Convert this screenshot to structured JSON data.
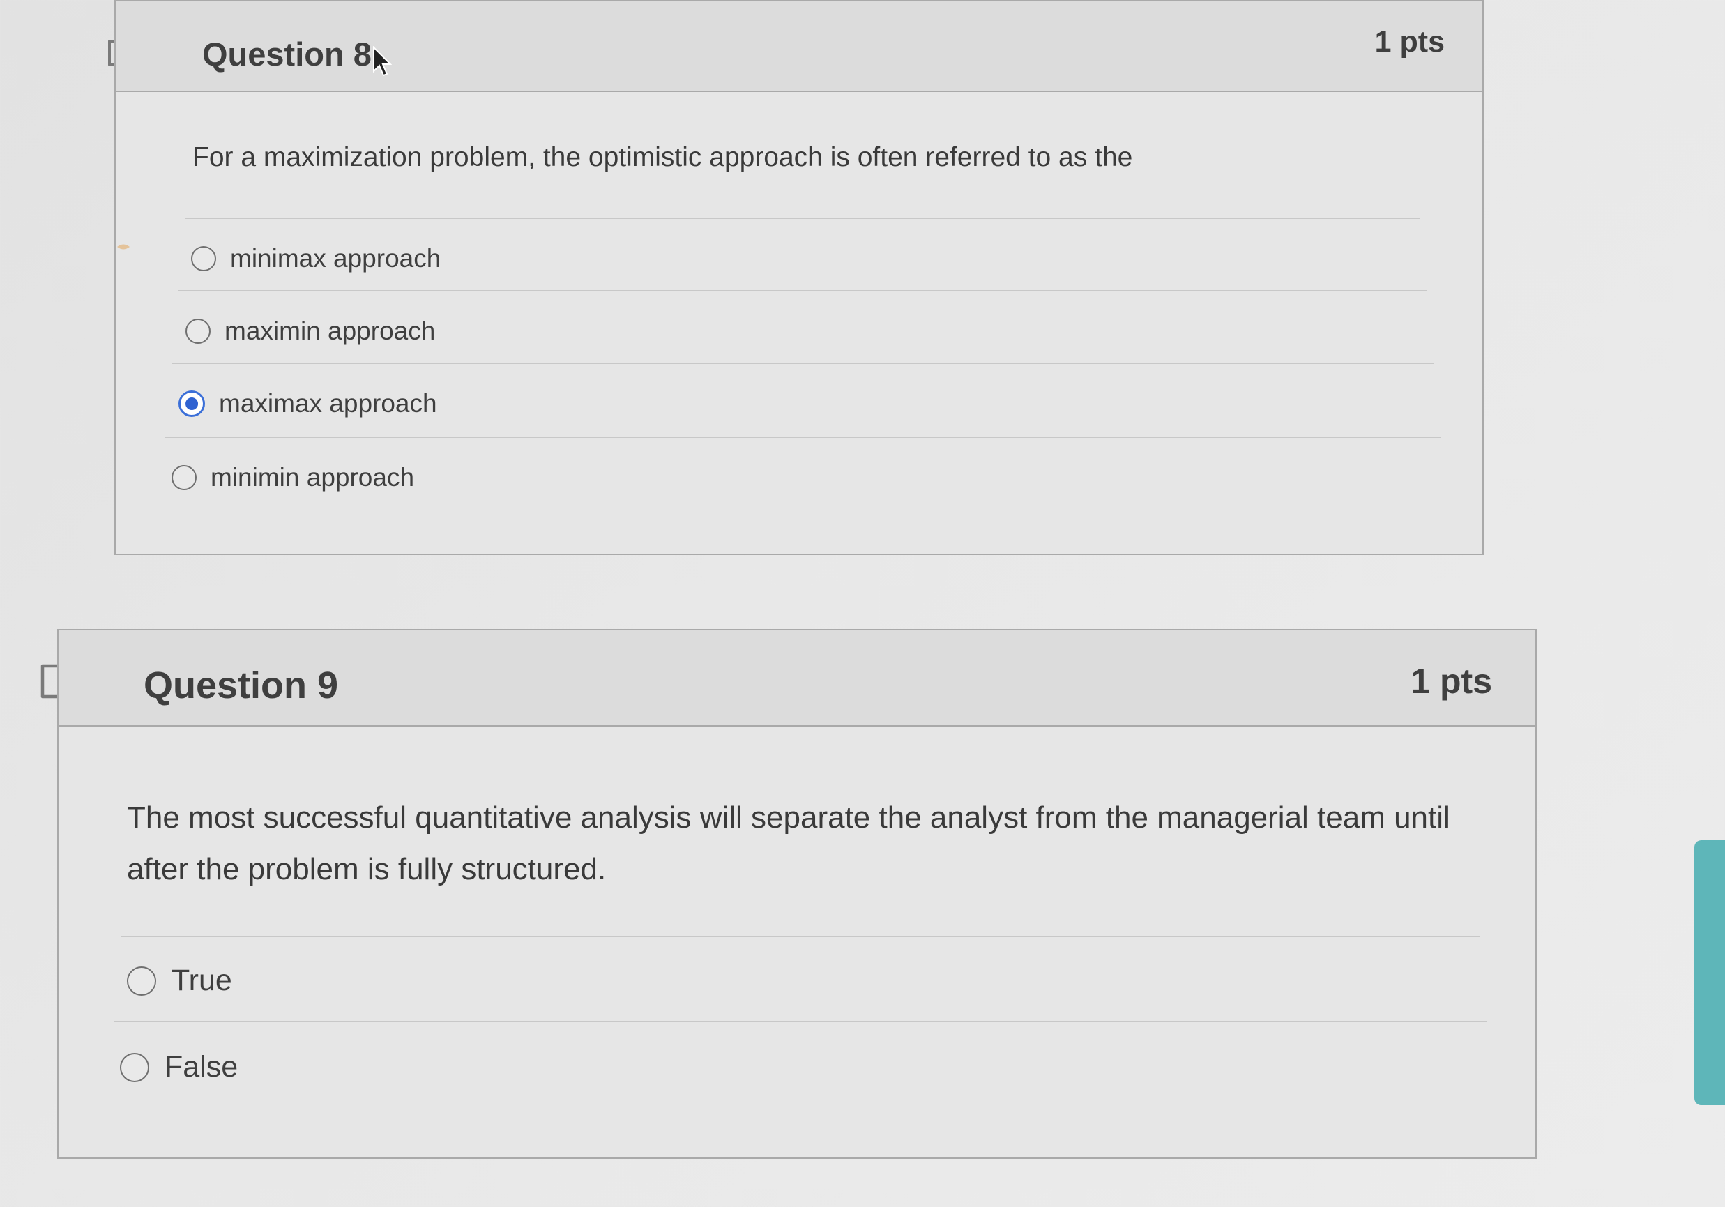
{
  "questions": [
    {
      "title": "Question 8",
      "points": "1 pts",
      "text": "For a maximization problem, the optimistic approach is often referred to as the",
      "answers": [
        {
          "label": "minimax approach",
          "selected": false
        },
        {
          "label": "maximin approach",
          "selected": false
        },
        {
          "label": "maximax approach",
          "selected": true
        },
        {
          "label": "minimin approach",
          "selected": false
        }
      ]
    },
    {
      "title": "Question 9",
      "points": "1 pts",
      "text": "The most successful quantitative analysis will separate the analyst from the managerial team until after the problem is fully structured.",
      "answers": [
        {
          "label": "True",
          "selected": false
        },
        {
          "label": "False",
          "selected": false
        }
      ]
    }
  ],
  "icons": {
    "flag": "flag-question-icon",
    "cursor": "mouse-pointer-icon",
    "radio_selected_color": "#2f62d1"
  }
}
